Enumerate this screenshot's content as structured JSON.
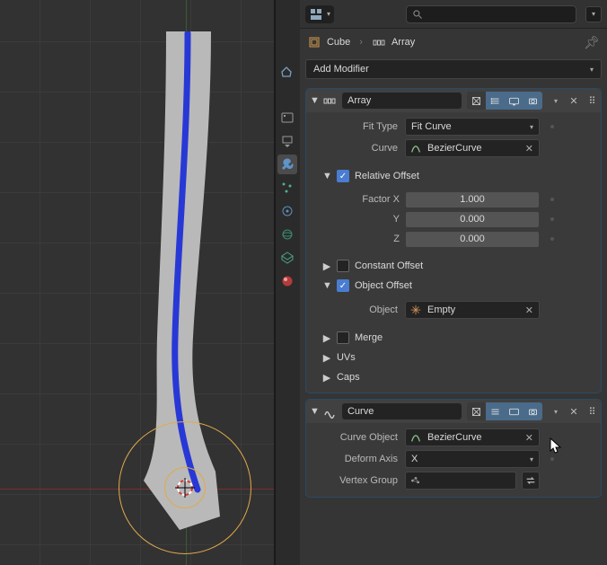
{
  "breadcrumb": {
    "object": "Cube",
    "modifier": "Array"
  },
  "add_modifier_label": "Add Modifier",
  "search": {
    "placeholder": ""
  },
  "modifiers": {
    "array": {
      "name": "Array",
      "fit_type_label": "Fit Type",
      "fit_type_value": "Fit Curve",
      "curve_label": "Curve",
      "curve_value": "BezierCurve",
      "relative_offset_label": "Relative Offset",
      "relative_offset_on": true,
      "factor_x_label": "Factor X",
      "factor_x": "1.000",
      "factor_y_label": "Y",
      "factor_y": "0.000",
      "factor_z_label": "Z",
      "factor_z": "0.000",
      "constant_offset_label": "Constant Offset",
      "constant_offset_on": false,
      "object_offset_label": "Object Offset",
      "object_offset_on": true,
      "object_label": "Object",
      "object_value": "Empty",
      "merge_label": "Merge",
      "merge_on": false,
      "uvs_label": "UVs",
      "caps_label": "Caps"
    },
    "curve": {
      "name": "Curve",
      "curve_object_label": "Curve Object",
      "curve_object_value": "BezierCurve",
      "deform_axis_label": "Deform Axis",
      "deform_axis_value": "X",
      "vertex_group_label": "Vertex Group",
      "vertex_group_value": ""
    }
  },
  "tabs": [
    "render",
    "output",
    "view-layer",
    "scene",
    "world",
    "object",
    "modifiers",
    "particles",
    "physics",
    "constraints",
    "data",
    "material"
  ],
  "colors": {
    "accent": "#4a7dd2",
    "panel_border": "#2b4a66"
  }
}
